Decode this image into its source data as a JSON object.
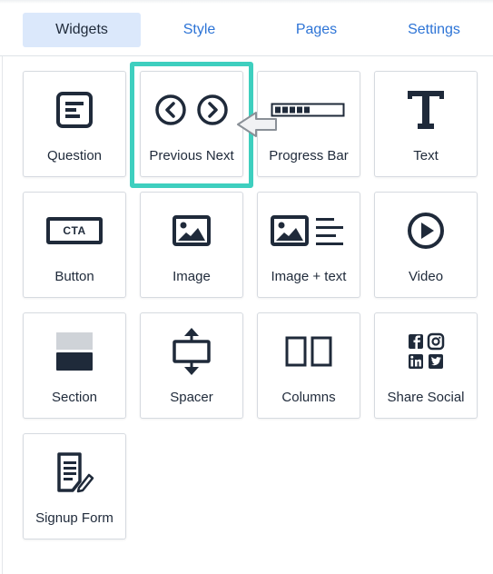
{
  "tabs": [
    {
      "label": "Widgets",
      "active": true
    },
    {
      "label": "Style",
      "active": false
    },
    {
      "label": "Pages",
      "active": false
    },
    {
      "label": "Settings",
      "active": false
    }
  ],
  "widgets": [
    {
      "label": "Question",
      "icon": "question-form-icon"
    },
    {
      "label": "Previous Next",
      "icon": "previous-next-arrows-icon",
      "highlighted": true
    },
    {
      "label": "Progress Bar",
      "icon": "progress-bar-icon"
    },
    {
      "label": "Text",
      "icon": "text-t-icon"
    },
    {
      "label": "Button",
      "icon": "cta-button-icon",
      "icon_text": "CTA"
    },
    {
      "label": "Image",
      "icon": "image-icon"
    },
    {
      "label": "Image + text",
      "icon": "image-text-icon"
    },
    {
      "label": "Video",
      "icon": "play-video-icon"
    },
    {
      "label": "Section",
      "icon": "section-icon"
    },
    {
      "label": "Spacer",
      "icon": "spacer-icon"
    },
    {
      "label": "Columns",
      "icon": "columns-icon"
    },
    {
      "label": "Share Social",
      "icon": "social-share-icon"
    },
    {
      "label": "Signup Form",
      "icon": "signup-form-icon"
    }
  ],
  "colors": {
    "accent": "#2d74d6",
    "active_tab_bg": "#dbe8fb",
    "highlight": "#3ecfbf",
    "icon": "#1f2a3a"
  }
}
